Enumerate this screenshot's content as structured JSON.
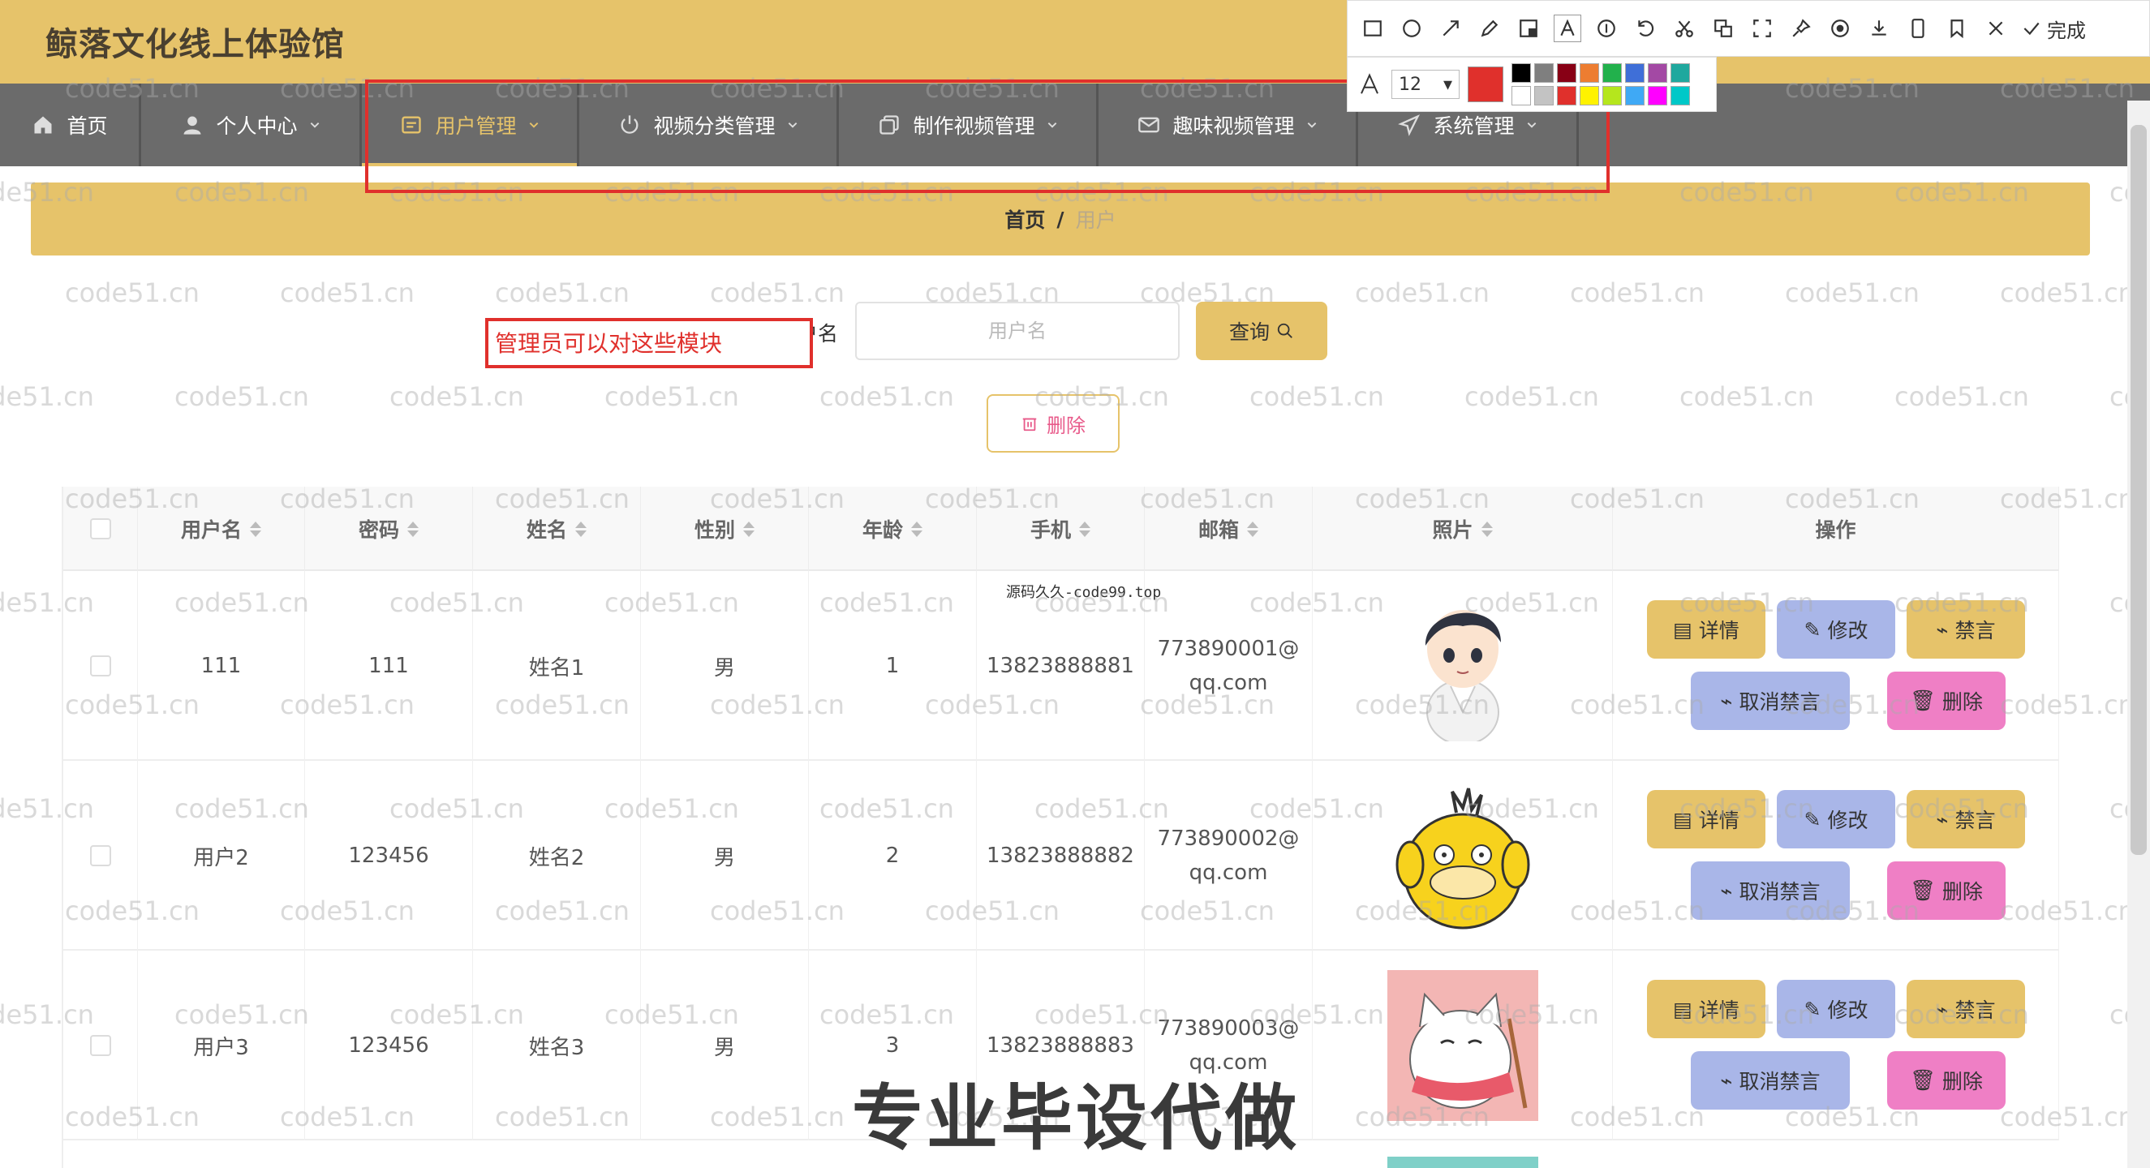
{
  "app": {
    "title": "鲸落文化线上体验馆"
  },
  "nav": [
    {
      "label": "首页",
      "icon": "home-icon",
      "has_dropdown": false,
      "active": false
    },
    {
      "label": "个人中心",
      "icon": "user-icon",
      "has_dropdown": true,
      "active": false
    },
    {
      "label": "用户管理",
      "icon": "list-icon",
      "has_dropdown": true,
      "active": true
    },
    {
      "label": "视频分类管理",
      "icon": "power-icon",
      "has_dropdown": true,
      "active": false
    },
    {
      "label": "制作视频管理",
      "icon": "copy-icon",
      "has_dropdown": true,
      "active": false
    },
    {
      "label": "趣味视频管理",
      "icon": "mail-icon",
      "has_dropdown": true,
      "active": false
    },
    {
      "label": "系统管理",
      "icon": "send-icon",
      "has_dropdown": true,
      "active": false
    }
  ],
  "breadcrumb": {
    "home": "首页",
    "separator": "/",
    "current": "用户"
  },
  "search": {
    "label": "用户名",
    "placeholder": "用户名",
    "query_label": "查询"
  },
  "delete_label": "删除",
  "table": {
    "columns": [
      "用户名",
      "密码",
      "姓名",
      "性别",
      "年龄",
      "手机",
      "邮箱",
      "照片",
      "操作"
    ],
    "rows": [
      {
        "username": "111",
        "password": "111",
        "name": "姓名1",
        "gender": "男",
        "age": "1",
        "phone": "13823888881",
        "email_line1": "773890001@",
        "email_line2": "qq.com",
        "photo": "boy-avatar"
      },
      {
        "username": "用户2",
        "password": "123456",
        "name": "姓名2",
        "gender": "男",
        "age": "2",
        "phone": "13823888882",
        "email_line1": "773890002@",
        "email_line2": "qq.com",
        "photo": "duck-avatar"
      },
      {
        "username": "用户3",
        "password": "123456",
        "name": "姓名3",
        "gender": "男",
        "age": "3",
        "phone": "13823888883",
        "email_line1": "773890003@",
        "email_line2": "qq.com",
        "photo": "cat-avatar"
      }
    ],
    "actions": {
      "detail": "详情",
      "edit": "修改",
      "ban": "禁言",
      "unban": "取消禁言",
      "delete": "删除"
    }
  },
  "annotation": {
    "text": "管理员可以对这些模块",
    "font_size": "12",
    "done_label": "完成",
    "current_color": "#e0302c",
    "palette": [
      "#000000",
      "#7f7f7f",
      "#880015",
      "#ed7d31",
      "#22b14c",
      "#3f6fd8",
      "#a349a4",
      "#1fa89e",
      "#ffffff",
      "#c3c3c3",
      "#e0302c",
      "#fff200",
      "#b5e61d",
      "#3fa9f5",
      "#ff00ff",
      "#00c8c8"
    ]
  },
  "watermark": "code51.cn",
  "source_note": "源码久久-code99.top",
  "caption": "专业毕设代做",
  "colors": {
    "header": "#e6c36a",
    "nav": "#6b6b6b",
    "accent": "#e6c36a",
    "edit": "#a9b6e8",
    "delete": "#ef7fc5"
  }
}
